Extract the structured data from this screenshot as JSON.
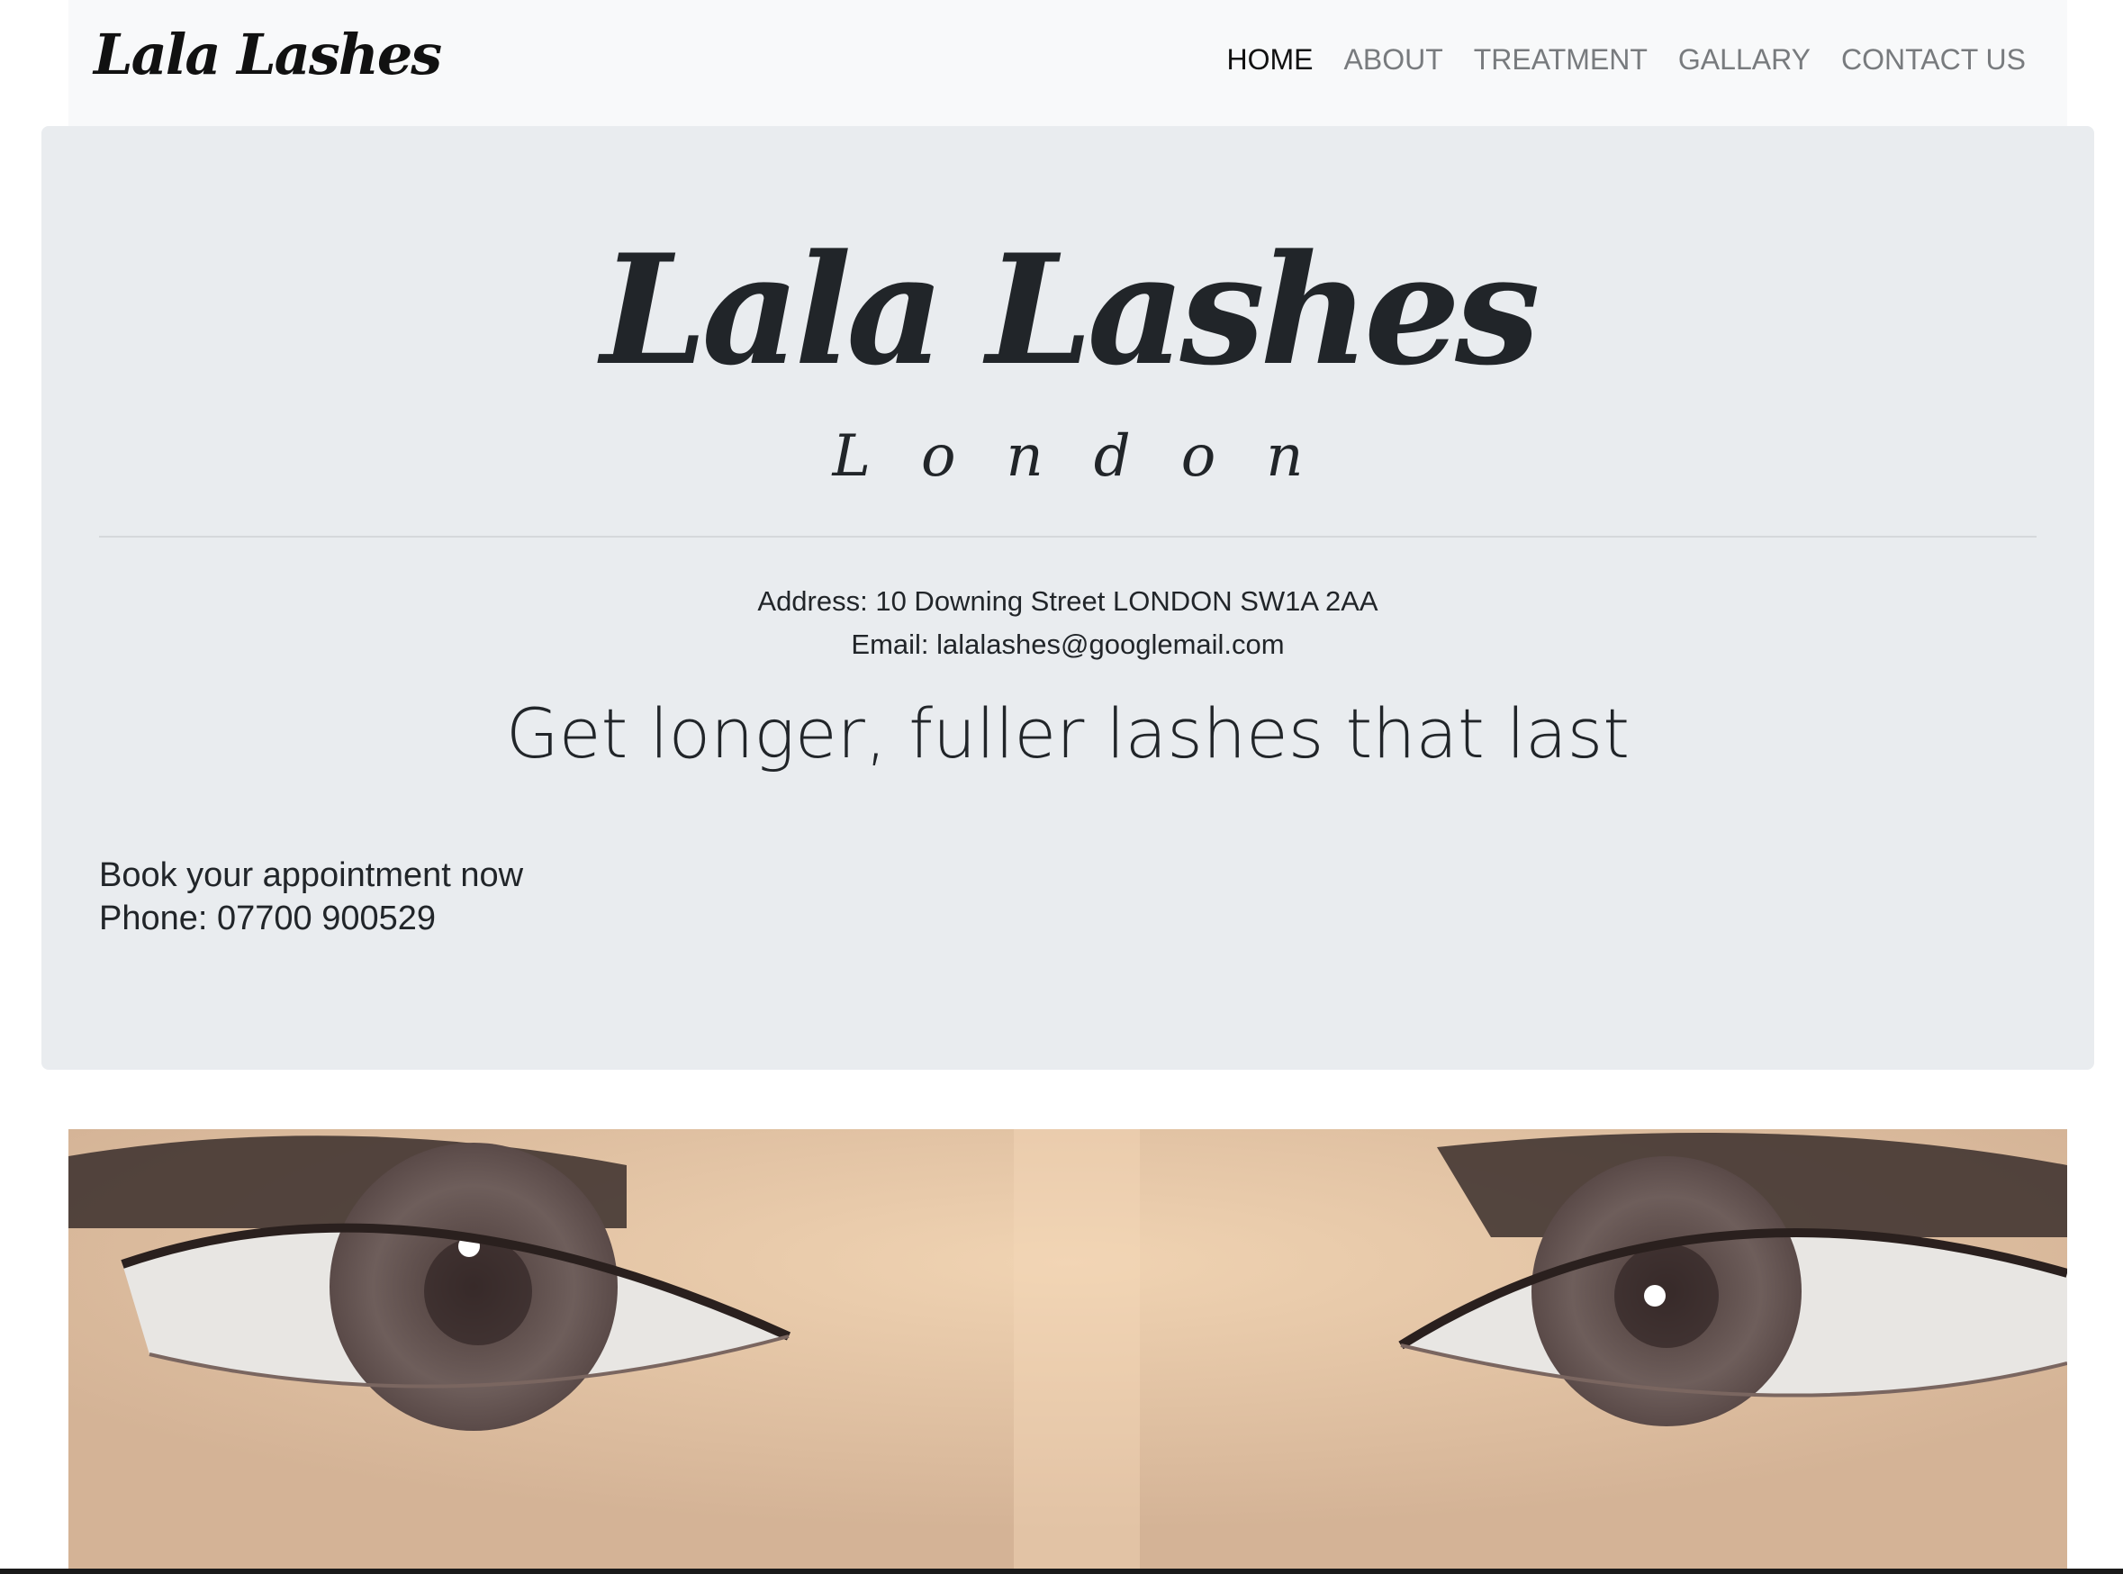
{
  "navbar": {
    "brand": "Lala Lashes",
    "links": [
      {
        "label": "HOME",
        "active": true
      },
      {
        "label": "ABOUT",
        "active": false
      },
      {
        "label": "TREATMENT",
        "active": false
      },
      {
        "label": "GALLARY",
        "active": false
      },
      {
        "label": "CONTACT US",
        "active": false
      }
    ]
  },
  "hero": {
    "title": "Lala Lashes",
    "subtitle": "London",
    "address": "Address: 10 Downing Street LONDON SW1A 2AA",
    "email": "Email: lalalashes@googlemail.com",
    "tagline": "Get longer, fuller lashes that last",
    "book_line": "Book your appointment now",
    "phone_line": "Phone: 07700 900529"
  },
  "colors": {
    "navbar_bg": "#f8f9fa",
    "jumbotron_bg": "#e9ecef",
    "text": "#212529",
    "nav_muted": "#787b7e"
  },
  "image": {
    "subject": "close-up of eyes with lash extensions"
  }
}
